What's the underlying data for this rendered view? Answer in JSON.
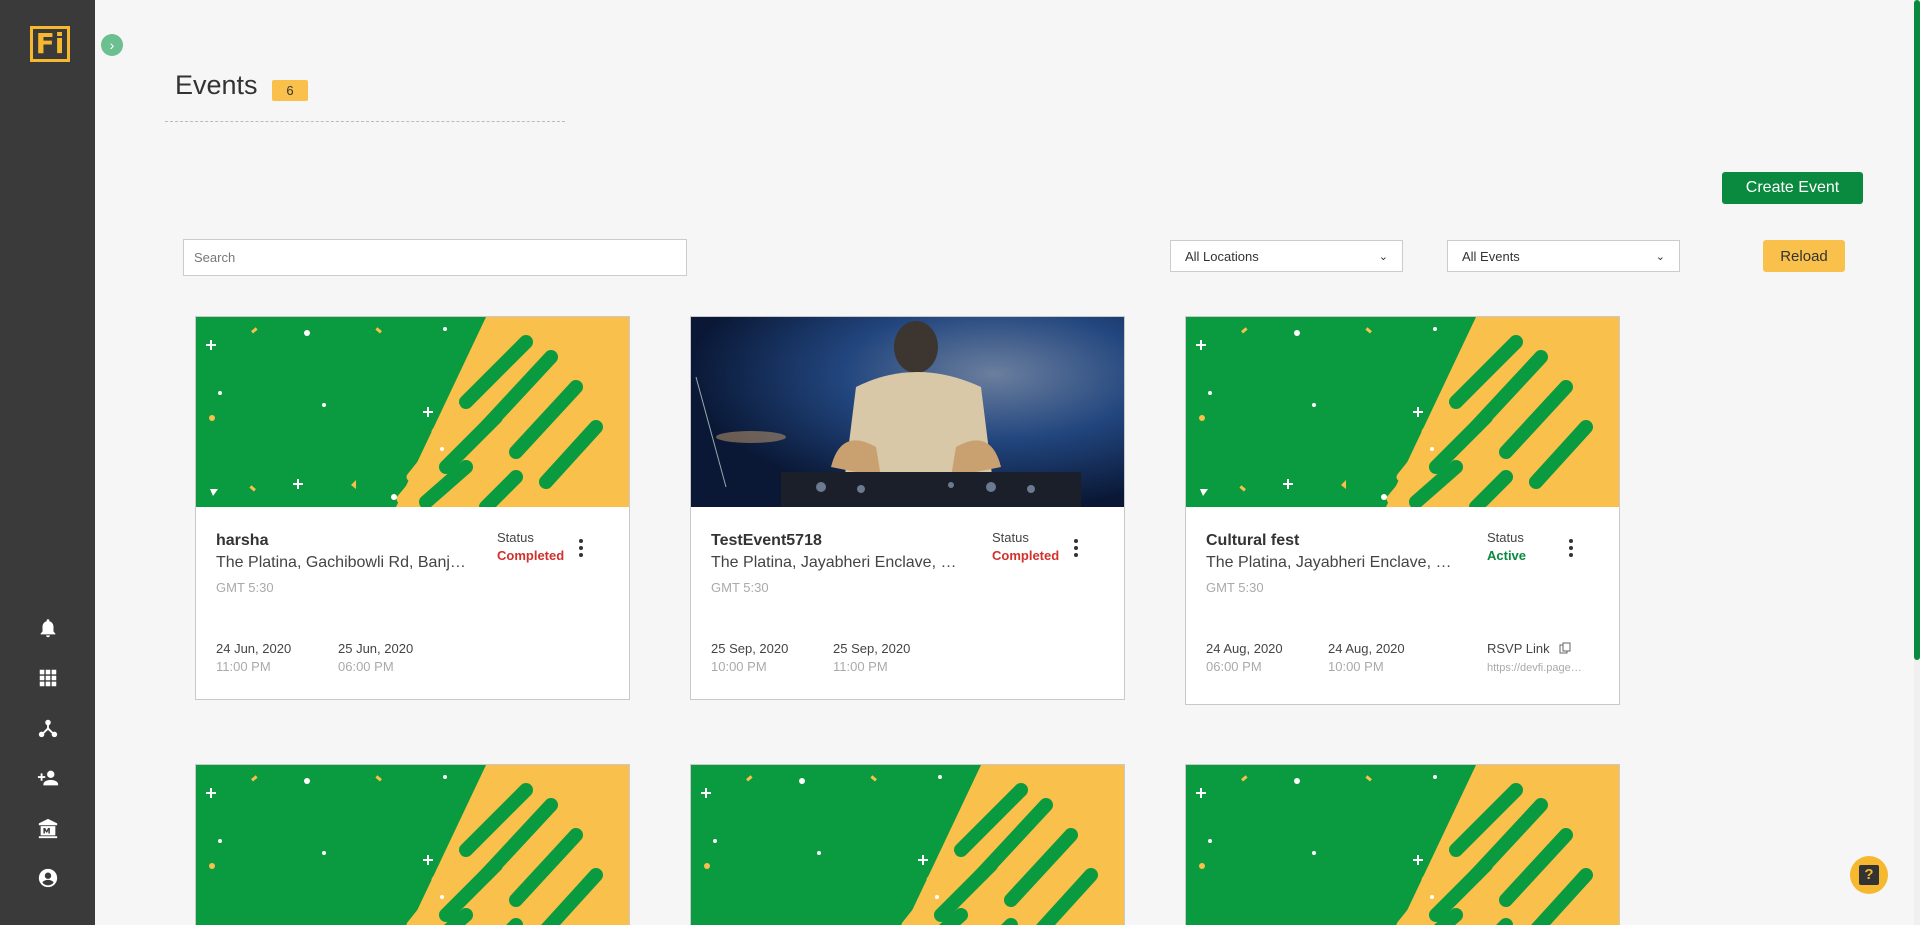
{
  "app": {
    "logo_text": "Fi",
    "accent": "#0a8a3f",
    "brand_yellow": "#f9c04b",
    "sidebar_bg": "#3a3a3a"
  },
  "sidebar": {
    "toggle_icon": "chevron-right-icon",
    "icons": [
      "bell-icon",
      "grid-icon",
      "network-icon",
      "add-user-icon",
      "bank-icon",
      "account-circle-icon"
    ]
  },
  "header": {
    "title": "Events",
    "count": "6"
  },
  "toolbar": {
    "create_label": "Create Event",
    "search_placeholder": "Search",
    "location_selected": "All Locations",
    "events_selected": "All Events",
    "reload_label": "Reload"
  },
  "events": [
    {
      "title": "harsha",
      "address": "The Platina, Gachibowli Rd, Banjara Hills",
      "timezone": "GMT 5:30",
      "status_label": "Status",
      "status": "Completed",
      "start_date": "24 Jun, 2020",
      "start_time": "11:00 PM",
      "end_date": "25 Jun, 2020",
      "end_time": "06:00 PM",
      "image": "banner"
    },
    {
      "title": "TestEvent5718",
      "address": "The Platina, Jayabheri Enclave, Gachibowli",
      "timezone": "GMT 5:30",
      "status_label": "Status",
      "status": "Completed",
      "start_date": "25 Sep, 2020",
      "start_time": "10:00 PM",
      "end_date": "25 Sep, 2020",
      "end_time": "11:00 PM",
      "image": "dj-photo"
    },
    {
      "title": "Cultural fest",
      "address": "The Platina, Jayabheri Enclave, Gachibowli",
      "timezone": "GMT 5:30",
      "status_label": "Status",
      "status": "Active",
      "start_date": "24 Aug, 2020",
      "start_time": "06:00 PM",
      "end_date": "24 Aug, 2020",
      "end_time": "10:00 PM",
      "rsvp_label": "RSVP Link",
      "rsvp_url": "https://devfi.page.link",
      "image": "banner"
    }
  ],
  "help": {
    "label": "?"
  }
}
